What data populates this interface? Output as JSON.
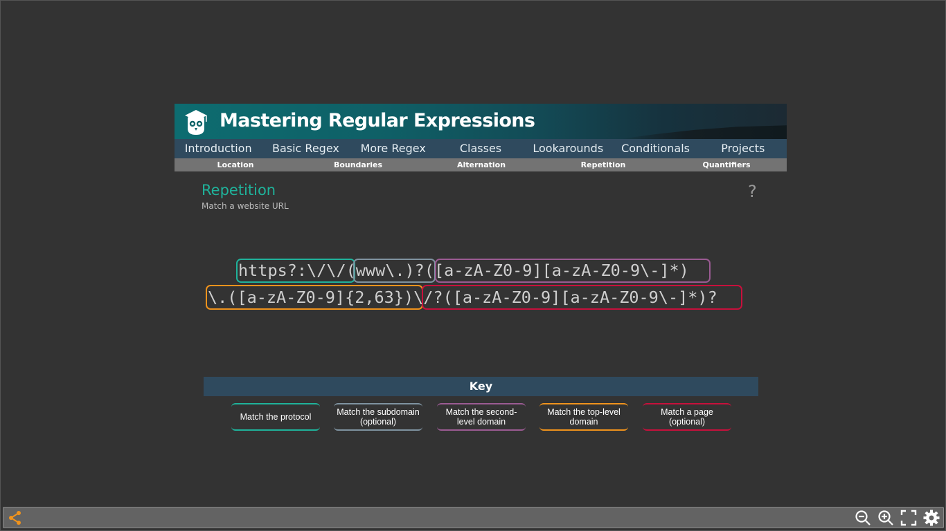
{
  "header": {
    "title": "Mastering Regular Expressions"
  },
  "nav": {
    "items": [
      "Introduction",
      "Basic Regex",
      "More Regex",
      "Classes",
      "Lookarounds",
      "Conditionals",
      "Projects"
    ]
  },
  "subnav": {
    "items": [
      "Location",
      "Boundaries",
      "Alternation",
      "Repetition",
      "Quantifiers"
    ]
  },
  "page": {
    "heading": "Repetition",
    "subheading": "Match a website URL",
    "help": "?"
  },
  "regex": {
    "line1": {
      "protocol": "https?:\\/\\/",
      "subdomain": "(www\\.)?",
      "second_level": "([a-zA-Z0-9][a-zA-Z0-9\\-]*)"
    },
    "line2": {
      "top_level": "\\.([a-zA-Z0-9]{2,63})",
      "page": "\\/?([a-zA-Z0-9][a-zA-Z0-9\\-]*)?"
    }
  },
  "key": {
    "title": "Key",
    "items": [
      {
        "label": "Match the protocol",
        "color": "#1fb39b"
      },
      {
        "label": "Match the subdomain (optional)",
        "color": "#7f93a0"
      },
      {
        "label": "Match the second-level domain",
        "color": "#9b5b93"
      },
      {
        "label": "Match the top-level domain",
        "color": "#f0931c"
      },
      {
        "label": "Match a page (optional)",
        "color": "#c8103c"
      }
    ]
  },
  "toolbar": {
    "icons": [
      "share-icon",
      "zoom-out-icon",
      "zoom-in-icon",
      "fullscreen-icon",
      "settings-icon"
    ],
    "accent": "#f0931c"
  }
}
